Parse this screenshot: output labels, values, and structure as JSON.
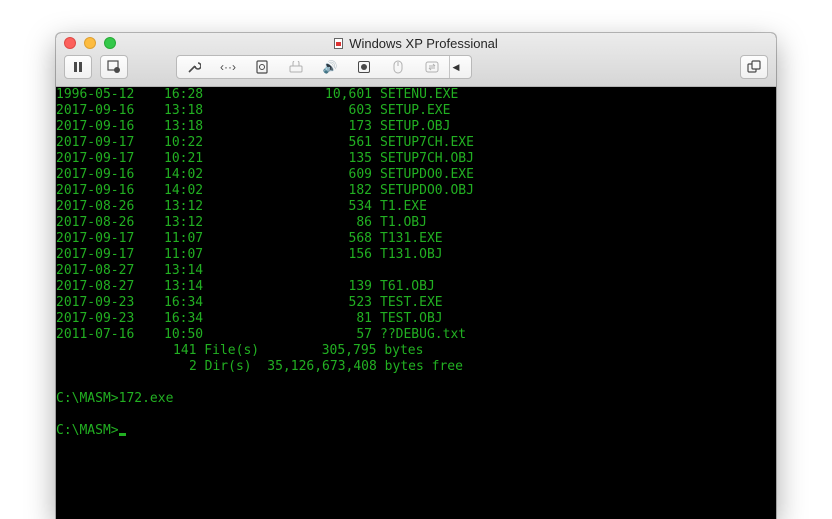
{
  "window": {
    "title": "Windows XP Professional"
  },
  "toolbar": {
    "icons": [
      "pause-icon",
      "snapshot-icon",
      "wrench-icon",
      "network-icon",
      "hard-disk-icon",
      "printer-icon",
      "audio-icon",
      "cd-rom-icon",
      "usb-icon",
      "shared-folders-icon",
      "chevron-left-icon",
      "unity-icon"
    ]
  },
  "terminal": {
    "listing": [
      {
        "date": "1996-05-12",
        "time": "16:28",
        "size": "10,601",
        "name": "SETENU.EXE"
      },
      {
        "date": "2017-09-16",
        "time": "13:18",
        "size": "603",
        "name": "SETUP.EXE"
      },
      {
        "date": "2017-09-16",
        "time": "13:18",
        "size": "173",
        "name": "SETUP.OBJ"
      },
      {
        "date": "2017-09-17",
        "time": "10:22",
        "size": "561",
        "name": "SETUP7CH.EXE"
      },
      {
        "date": "2017-09-17",
        "time": "10:21",
        "size": "135",
        "name": "SETUP7CH.OBJ"
      },
      {
        "date": "2017-09-16",
        "time": "14:02",
        "size": "609",
        "name": "SETUPDO0.EXE"
      },
      {
        "date": "2017-09-16",
        "time": "14:02",
        "size": "182",
        "name": "SETUPDO0.OBJ"
      },
      {
        "date": "2017-08-26",
        "time": "13:12",
        "size": "534",
        "name": "T1.EXE"
      },
      {
        "date": "2017-08-26",
        "time": "13:12",
        "size": "86",
        "name": "T1.OBJ"
      },
      {
        "date": "2017-09-17",
        "time": "11:07",
        "size": "568",
        "name": "T131.EXE"
      },
      {
        "date": "2017-09-17",
        "time": "11:07",
        "size": "156",
        "name": "T131.OBJ"
      },
      {
        "date": "2017-08-27",
        "time": "13:14",
        "size": "",
        "name": ""
      },
      {
        "date": "2017-08-27",
        "time": "13:14",
        "size": "139",
        "name": "T61.OBJ"
      },
      {
        "date": "2017-09-23",
        "time": "16:34",
        "size": "523",
        "name": "TEST.EXE"
      },
      {
        "date": "2017-09-23",
        "time": "16:34",
        "size": "81",
        "name": "TEST.OBJ"
      },
      {
        "date": "2011-07-16",
        "time": "10:50",
        "size": "57",
        "name": "??DEBUG.txt"
      }
    ],
    "summary_files": "141 File(s)        305,795 bytes",
    "summary_dirs": "2 Dir(s)  35,126,673,408 bytes free",
    "command_1": "C:\\MASM>172.exe",
    "prompt": "C:\\MASM>"
  },
  "colors": {
    "terminal_text": "#22b022",
    "terminal_bg": "#000000"
  }
}
